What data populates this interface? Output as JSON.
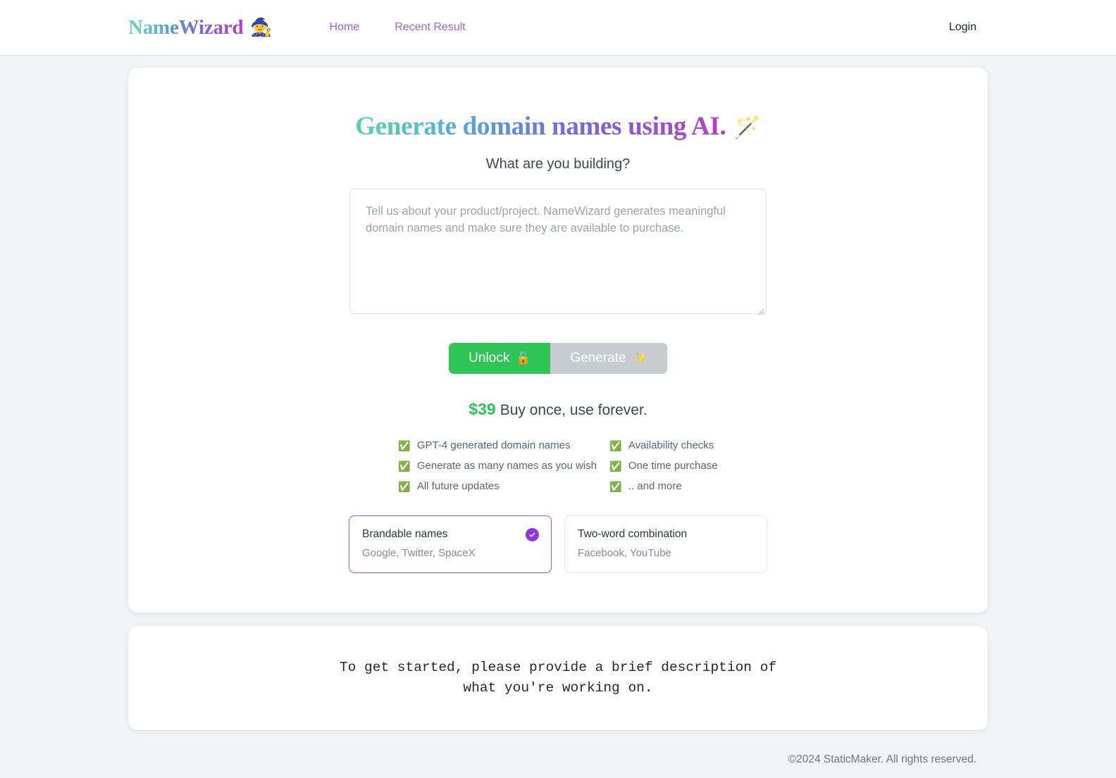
{
  "header": {
    "brand_name": "NameWizard",
    "brand_emoji": "🧙",
    "nav": [
      {
        "label": "Home"
      },
      {
        "label": "Recent Result"
      }
    ],
    "login_label": "Login"
  },
  "hero": {
    "title": "Generate domain names using AI.",
    "title_emoji": "🪄",
    "subtitle": "What are you building?",
    "prompt_placeholder": "Tell us about your product/project. NameWizard generates meaningful domain names and make sure they are available to purchase.",
    "prompt_value": ""
  },
  "actions": {
    "unlock_label": "Unlock",
    "unlock_emoji": "🔓",
    "unlock_color": "#2ec556",
    "generate_label": "Generate",
    "generate_emoji": "✨",
    "generate_color": "#c7ccd2"
  },
  "pricing": {
    "amount": "$39",
    "tagline": "Buy once, use forever.",
    "amount_color": "#2ec556"
  },
  "features": [
    {
      "check": "✅",
      "label": "GPT-4 generated domain names"
    },
    {
      "check": "✅",
      "label": "Availability checks"
    },
    {
      "check": "✅",
      "label": "Generate as many names as you wish"
    },
    {
      "check": "✅",
      "label": "One time purchase"
    },
    {
      "check": "✅",
      "label": "All future updates"
    },
    {
      "check": "✅",
      "label": ".. and more"
    }
  ],
  "options": [
    {
      "title": "Brandable names",
      "examples": "Google, Twitter, SpaceX",
      "selected": true,
      "accent": "#9333ea"
    },
    {
      "title": "Two-word combination",
      "examples": "Facebook, YouTube",
      "selected": false
    }
  ],
  "status": {
    "message": "To get started, please provide a brief description of what you're working on."
  },
  "footer": {
    "copyright": "©2024 StaticMaker. All rights reserved."
  }
}
